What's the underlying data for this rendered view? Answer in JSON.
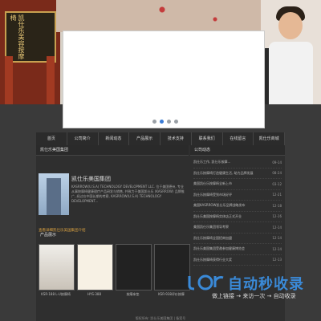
{
  "banner": {
    "sign_text": "凯仕乐美容按摩椅",
    "slider_dots": 4,
    "slider_active": 1
  },
  "nav": {
    "items": [
      "首页",
      "公司简介",
      "新闻动态",
      "产品展示",
      "技术支持",
      "联系我们",
      "在线留言",
      "凯仕乐商城"
    ]
  },
  "about": {
    "header": "凯仕乐美国集团",
    "title": "凯仕乐美国集团",
    "text": "KASRROW(U.S.A) TECHNOLOGY DEVELOPMENT LLC. 位于美国德州, 专业从事按摩椅健康理疗产品研发与销售, 并致力于美国凯仕乐 (KASRROW) 品牌推广, 经过在中国长期的考察, KASRROW(U.S.A) TECHNOLOGY DEVELOPMENT...",
    "more": "查看详细凯仕乐美国集团介绍"
  },
  "products": {
    "header": "产品展示",
    "items": [
      {
        "caption": "KSR-188 L-U按摩椅"
      },
      {
        "caption": "HYS-388"
      },
      {
        "caption": "按摩床垫"
      },
      {
        "caption": "KSR-938评价按摩"
      }
    ]
  },
  "news": {
    "header": "公司动态",
    "items": [
      {
        "title": "凯仕乐工作, 凯仕乐按摩...",
        "date": "09-14"
      },
      {
        "title": "凯仕乐按摩椅打造健康生活, 助力品牌发展",
        "date": "08-24"
      },
      {
        "title": "美国凯仕乐按摩椅全新上市",
        "date": "03-12"
      },
      {
        "title": "凯仕乐按摩椅受到市场好评",
        "date": "12-21"
      },
      {
        "title": "美国KASRROW凯仕乐品牌战略发布",
        "date": "12-18"
      },
      {
        "title": "凯仕乐美国按摩椅实体店正式开业",
        "date": "12-16"
      },
      {
        "title": "美国凯仕乐集团领导考察",
        "date": "12-14"
      },
      {
        "title": "凯仕乐按摩椅全国招商加盟",
        "date": "12-14"
      },
      {
        "title": "凯仕乐美国集团受邀参加健康博览会",
        "date": "12-14"
      },
      {
        "title": "凯仕乐按摩椅获得行业大奖",
        "date": "12-13"
      }
    ]
  },
  "watermark": {
    "main": "自动秒收录",
    "sub": "做上链接 → 来访一次 → 自动收录"
  },
  "footer": {
    "text": "版权所有: 凯仕乐美国集团 | 备案号"
  },
  "colors": {
    "background": "#3a3a3a",
    "panel": "#2f2f2f",
    "accent": "#d8a040",
    "watermark_blue": "#3a8ad8"
  }
}
